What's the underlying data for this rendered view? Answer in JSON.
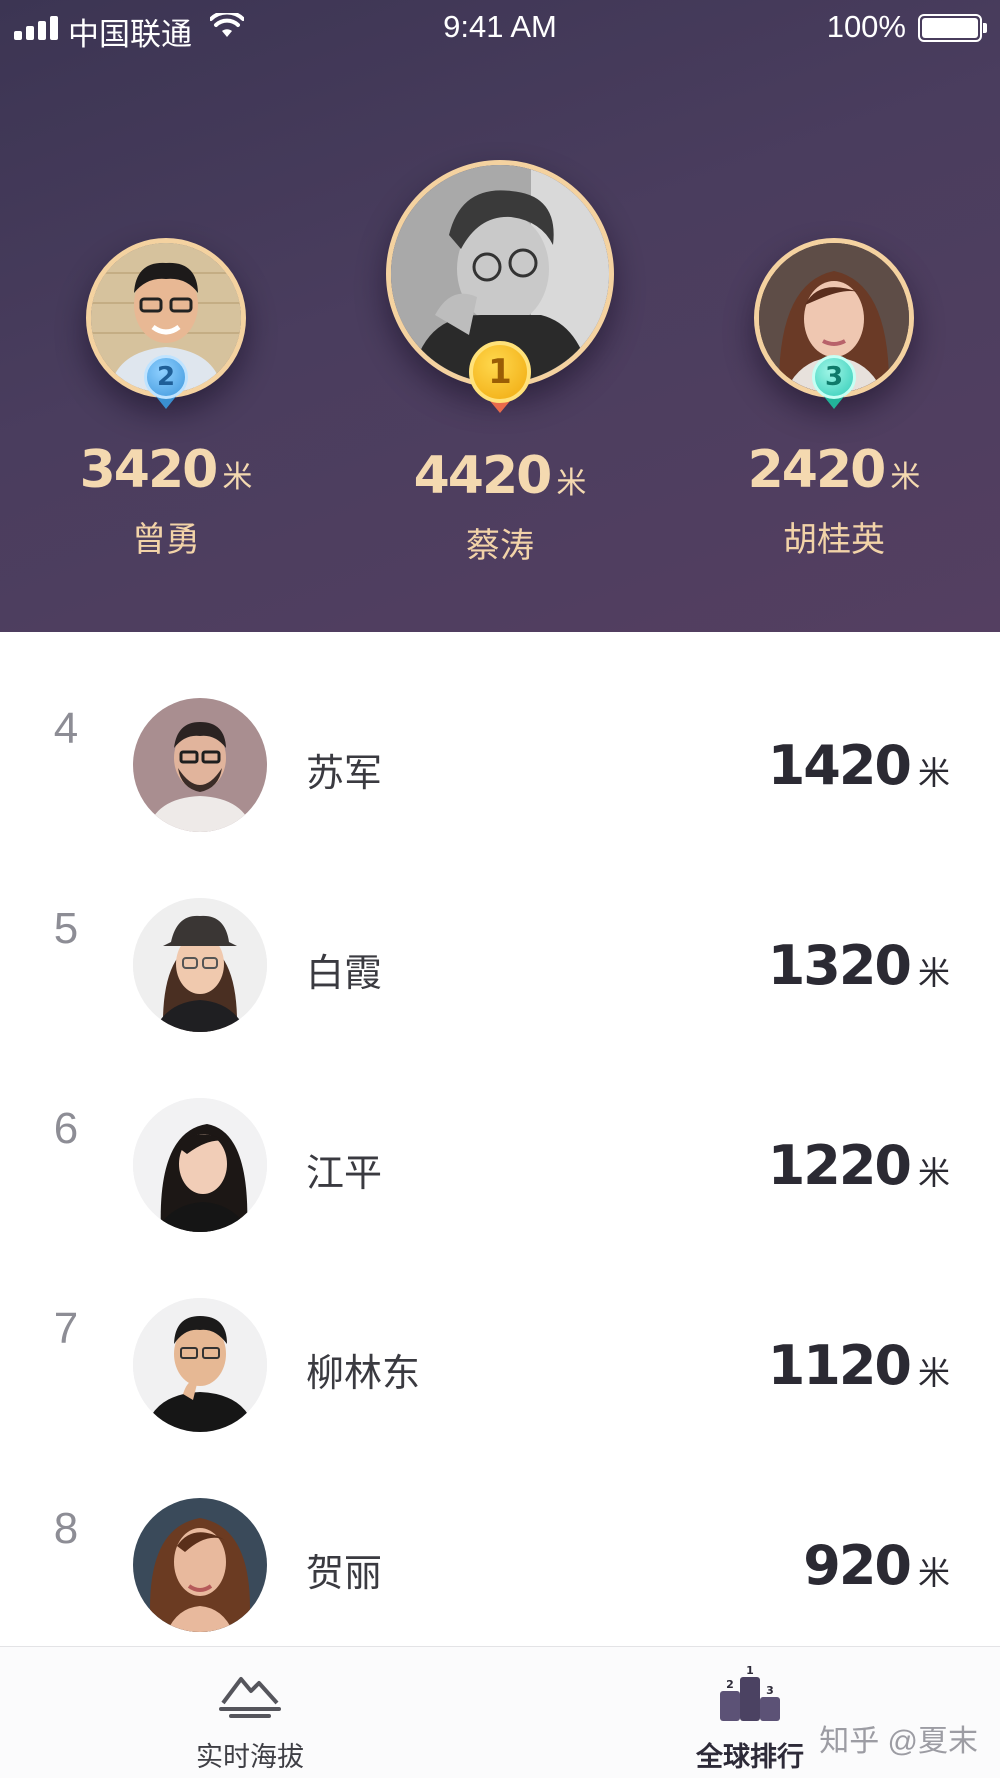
{
  "status_bar": {
    "carrier": "中国联通",
    "time": "9:41 AM",
    "battery": "100%"
  },
  "podium": [
    {
      "rank": "2",
      "score": "3420",
      "unit": "米",
      "name": "曾勇",
      "medal_color": "#4aa3e0",
      "ribbon_color": "#3a8fd0"
    },
    {
      "rank": "1",
      "score": "4420",
      "unit": "米",
      "name": "蔡涛",
      "medal_color": "#f1b417",
      "ribbon_color": "#e96b4b"
    },
    {
      "rank": "3",
      "score": "2420",
      "unit": "米",
      "name": "胡桂英",
      "medal_color": "#3fd6c2",
      "ribbon_color": "#22b49a"
    }
  ],
  "ranking": [
    {
      "rank": "4",
      "name": "苏军",
      "score": "1420",
      "unit": "米"
    },
    {
      "rank": "5",
      "name": "白霞",
      "score": "1320",
      "unit": "米"
    },
    {
      "rank": "6",
      "name": "江平",
      "score": "1220",
      "unit": "米"
    },
    {
      "rank": "7",
      "name": "柳林东",
      "score": "1120",
      "unit": "米"
    },
    {
      "rank": "8",
      "name": "贺丽",
      "score": "920",
      "unit": "米"
    }
  ],
  "tabs": [
    {
      "label": "实时海拔",
      "icon": "mountain-icon",
      "active": false
    },
    {
      "label": "全球排行",
      "icon": "podium-icon",
      "active": true
    }
  ],
  "podium_icon_digits": [
    "1",
    "2",
    "3"
  ],
  "watermark": "知乎 @夏末",
  "colors": {
    "header_bg": "#463b5c",
    "gold_text": "#f4d9b0",
    "avatar_ring": "#f4d2a0"
  }
}
